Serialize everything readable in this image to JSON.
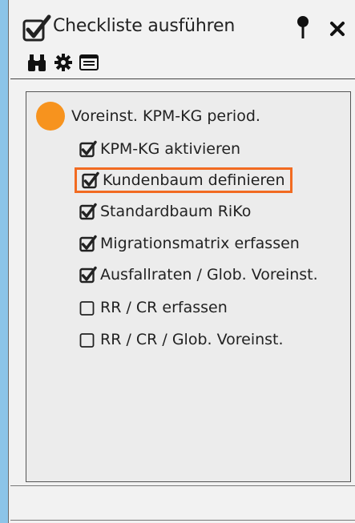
{
  "window": {
    "title": "Checkliste ausführen"
  },
  "titlebar_icons": {
    "pin": "pin-icon",
    "close": "close-icon"
  },
  "toolbar": {
    "icons": [
      "binoculars-icon",
      "gear-icon",
      "list-icon"
    ]
  },
  "tree": {
    "root": {
      "label": "Voreinst. KPM-KG period.",
      "status_color": "#f7931e"
    },
    "items": [
      {
        "label": "KPM-KG aktivieren",
        "checked": true,
        "selected": false
      },
      {
        "label": "Kundenbaum definieren",
        "checked": true,
        "selected": true
      },
      {
        "label": "Standardbaum RiKo",
        "checked": true,
        "selected": false
      },
      {
        "label": "Migrationsmatrix erfassen",
        "checked": true,
        "selected": false
      },
      {
        "label": "Ausfallraten / Glob. Voreinst.",
        "checked": true,
        "selected": false
      },
      {
        "label": "RR / CR erfassen",
        "checked": false,
        "selected": false
      },
      {
        "label": "RR / CR / Glob. Voreinst.",
        "checked": false,
        "selected": false
      }
    ]
  },
  "colors": {
    "selection_border": "#f26b21",
    "accent_strip": "#8cc4e8"
  }
}
